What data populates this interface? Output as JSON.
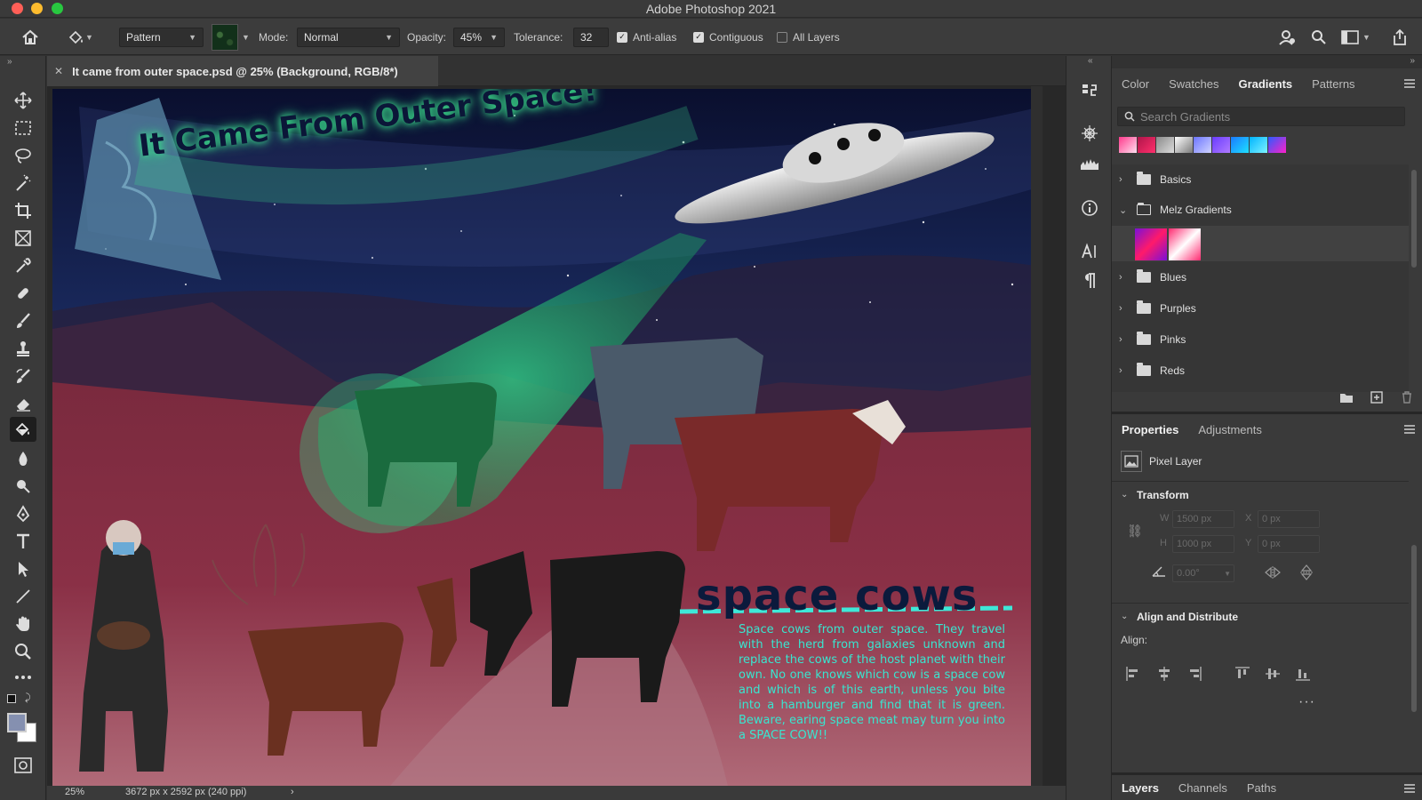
{
  "app": {
    "title": "Adobe Photoshop 2021"
  },
  "options_bar": {
    "source_value": "Pattern",
    "mode_label": "Mode:",
    "mode_value": "Normal",
    "opacity_label": "Opacity:",
    "opacity_value": "45%",
    "tolerance_label": "Tolerance:",
    "tolerance_value": "32",
    "anti_alias_label": "Anti-alias",
    "anti_alias_checked": true,
    "contiguous_label": "Contiguous",
    "contiguous_checked": true,
    "all_layers_label": "All Layers",
    "all_layers_checked": false
  },
  "document": {
    "tab_title": "It came from outer space.psd @ 25% (Background, RGB/8*)",
    "zoom": "25%",
    "dimensions": "3672 px x 2592 px (240 ppi)",
    "artwork": {
      "headline": "It Came From Outer Space!",
      "heading": "space cows",
      "body": "Space cows from outer space. They travel with the herd from galaxies unknown and replace the cows of the host planet with their own. No one knows which cow is a space cow and which is of this earth, unless you bite into a hamburger and find that it is green. Beware, earing space meat may turn you into a SPACE COW!!"
    }
  },
  "gradients_panel": {
    "tabs": [
      "Color",
      "Swatches",
      "Gradients",
      "Patterns"
    ],
    "selected_tab": "Gradients",
    "search_placeholder": "Search Gradients",
    "preset_swatch_colors": [
      [
        "#ff3a8c",
        "#ffe0f0"
      ],
      [
        "#b0154a",
        "#ff2f6c"
      ],
      [
        "#8a8a8a",
        "#dcdcdc"
      ],
      [
        "#ffffff",
        "#7a7a7a"
      ],
      [
        "#6b74ff",
        "#d0d4ff"
      ],
      [
        "#6a3cff",
        "#b07bff"
      ],
      [
        "#1a7bff",
        "#1ee0ff"
      ],
      [
        "#00b4ff",
        "#7df3ff"
      ],
      [
        "#2b5bff",
        "#ff20c8"
      ]
    ],
    "groups": [
      {
        "name": "Basics",
        "expanded": false
      },
      {
        "name": "Melz Gradients",
        "expanded": true
      },
      {
        "name": "Blues",
        "expanded": false
      },
      {
        "name": "Purples",
        "expanded": false
      },
      {
        "name": "Pinks",
        "expanded": false
      },
      {
        "name": "Reds",
        "expanded": false
      }
    ]
  },
  "properties_panel": {
    "tabs": [
      "Properties",
      "Adjustments"
    ],
    "selected_tab": "Properties",
    "layer_type": "Pixel Layer",
    "transform_title": "Transform",
    "w_label": "W",
    "w_value": "1500 px",
    "h_label": "H",
    "h_value": "1000 px",
    "x_label": "X",
    "x_value": "0 px",
    "y_label": "Y",
    "y_value": "0 px",
    "angle_value": "0.00°",
    "align_title": "Align and Distribute",
    "align_label": "Align:"
  },
  "layers_panel": {
    "tabs": [
      "Layers",
      "Channels",
      "Paths"
    ],
    "selected_tab": "Layers"
  }
}
